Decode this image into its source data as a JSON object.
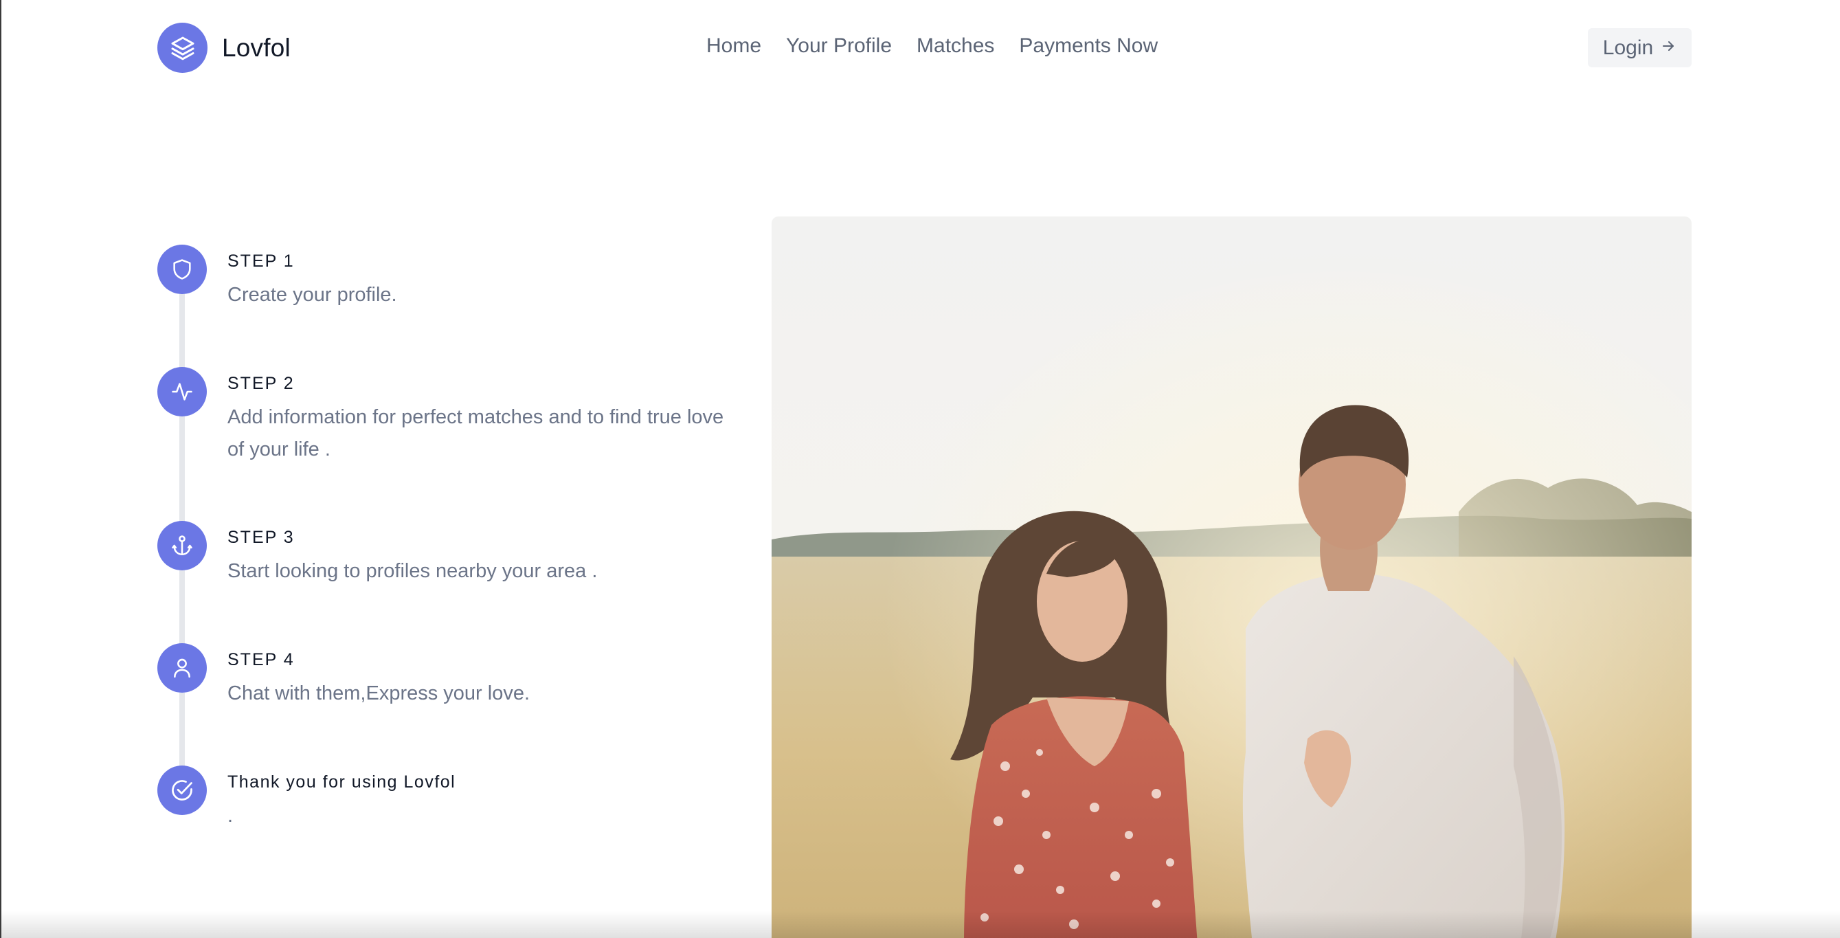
{
  "brand": {
    "name": "Lovfol",
    "logo_icon": "stack-layers-icon",
    "accent": "#6b77e5"
  },
  "nav": {
    "items": [
      {
        "label": "Home"
      },
      {
        "label": "Your Profile"
      },
      {
        "label": "Matches"
      },
      {
        "label": "Payments Now"
      }
    ]
  },
  "login": {
    "label": "Login",
    "icon": "arrow-right-icon"
  },
  "steps": [
    {
      "title": "STEP 1",
      "description": "Create your profile.",
      "icon": "shield-icon"
    },
    {
      "title": "STEP 2",
      "description": "Add information for perfect matches and to find true love of your life .",
      "icon": "activity-pulse-icon"
    },
    {
      "title": "STEP 3",
      "description": "Start looking to profiles nearby your area .",
      "icon": "anchor-icon"
    },
    {
      "title": "STEP 4",
      "description": "Chat with them,Express your love.",
      "icon": "user-icon"
    },
    {
      "title": "Thank you for using Lovfol",
      "description": ".",
      "icon": "check-circle-icon"
    }
  ],
  "photo": {
    "subject": "couple-embracing-in-field"
  }
}
